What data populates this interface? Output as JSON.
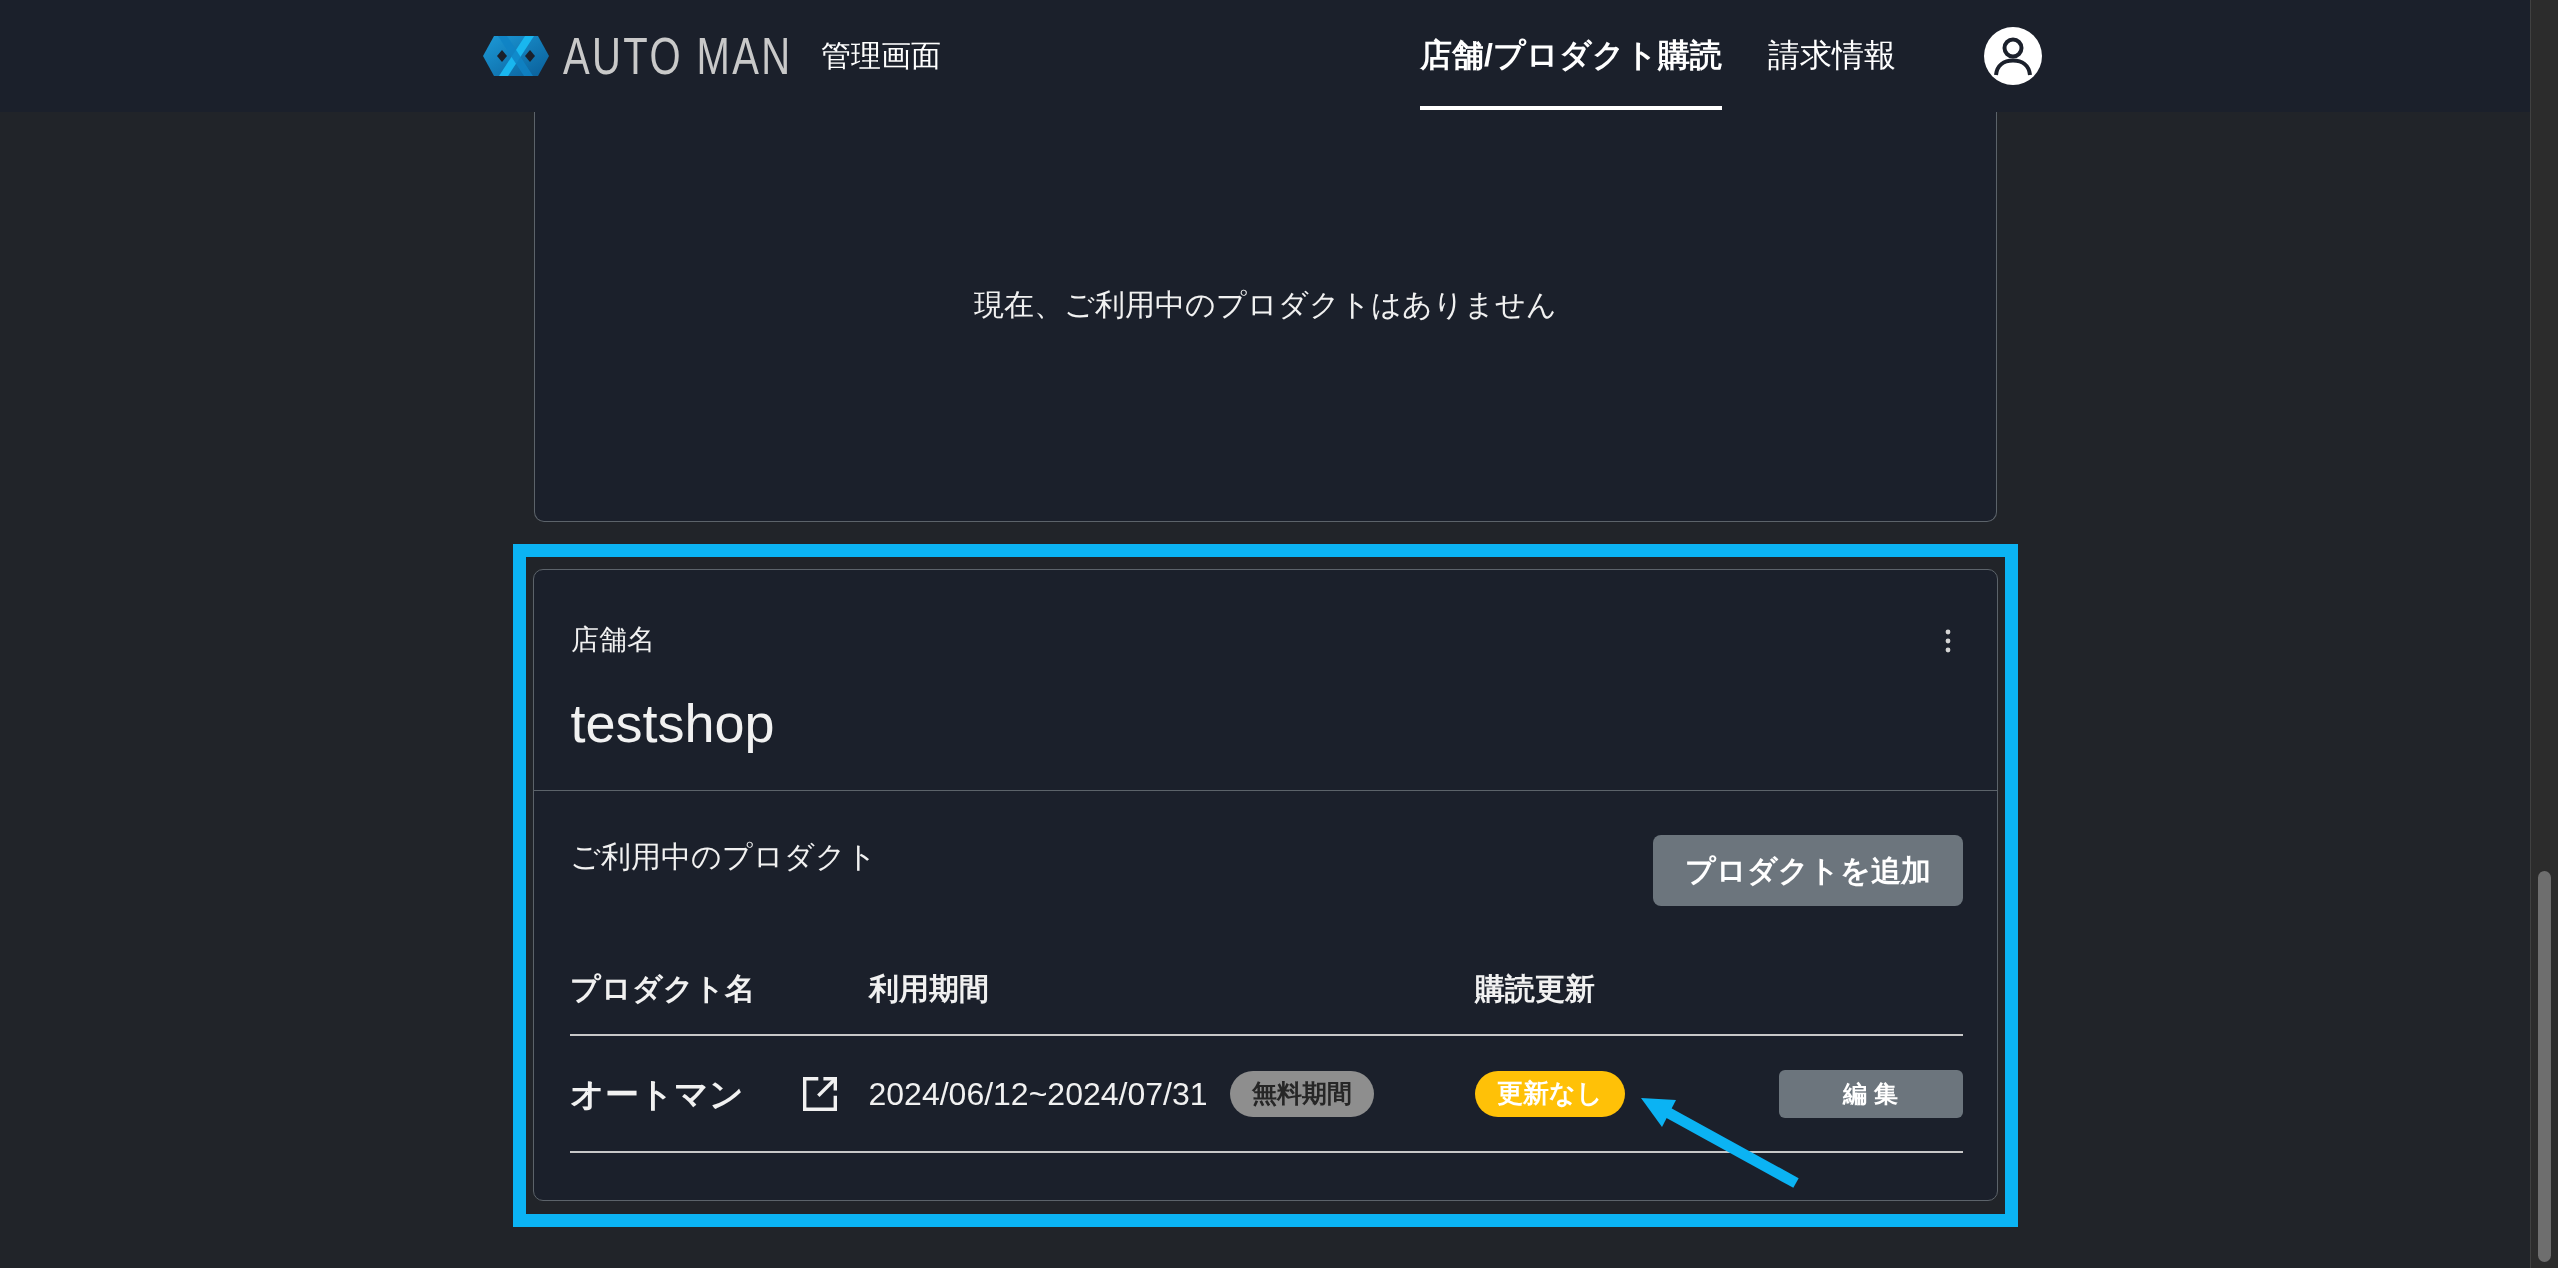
{
  "header": {
    "logo_text": "AUTO MAN",
    "subtitle": "管理画面",
    "nav": [
      {
        "label": "店舗/プロダクト購読",
        "selected": true
      },
      {
        "label": "請求情報",
        "selected": false
      }
    ]
  },
  "empty_card": {
    "message": "現在、ご利用中のプロダクトはありません"
  },
  "store_card": {
    "highlighted": true,
    "label": "店舗名",
    "name": "testshop",
    "products_title": "ご利用中のプロダクト",
    "add_button": "プロダクトを追加",
    "table": {
      "columns": [
        "プロダクト名",
        "利用期間",
        "購読更新"
      ],
      "rows": [
        {
          "product": "オートマン",
          "period": "2024/06/12~2024/07/31",
          "period_badge": "無料期間",
          "renewal": "更新なし",
          "edit_button": "編 集",
          "arrow": true
        }
      ]
    }
  }
}
